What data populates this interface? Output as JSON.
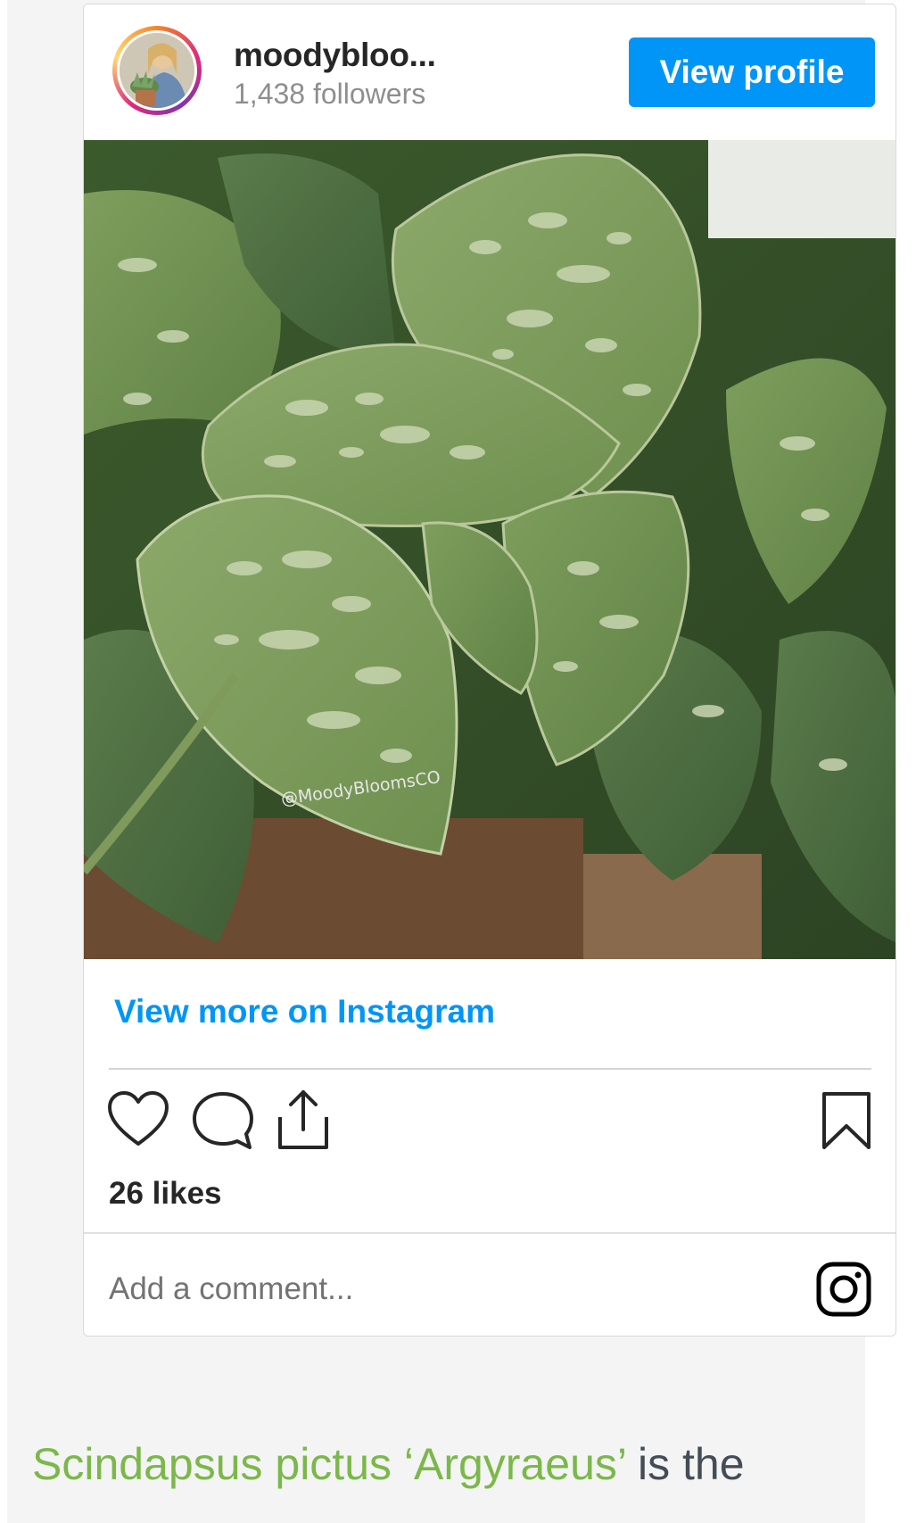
{
  "embed": {
    "username": "moodybloo...",
    "followers": "1,438 followers",
    "view_profile_label": "View profile",
    "photo_watermark": "@MoodyBloomsCO",
    "view_more_label": "View more on Instagram",
    "likes": "26 likes",
    "comment_placeholder": "Add a comment...",
    "icons": [
      "heart-icon",
      "comment-icon",
      "share-icon",
      "bookmark-icon",
      "instagram-icon"
    ]
  },
  "article": {
    "plant_name": "Scindapsus pictus ‘Argyraeus’",
    "text_after": " is the"
  },
  "colors": {
    "accent": "#0095f6",
    "plant_name": "#7bb84a",
    "body_text": "#444d57"
  }
}
